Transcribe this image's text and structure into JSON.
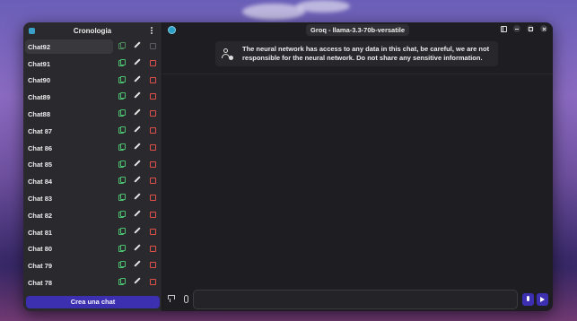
{
  "sidebar": {
    "title": "Cronologia",
    "chats": [
      {
        "label": "Chat92",
        "active": true
      },
      {
        "label": "Chat91"
      },
      {
        "label": "Chat90"
      },
      {
        "label": "Chat89"
      },
      {
        "label": "Chat88"
      },
      {
        "label": "Chat 87"
      },
      {
        "label": "Chat 86"
      },
      {
        "label": "Chat 85"
      },
      {
        "label": "Chat 84"
      },
      {
        "label": "Chat 83"
      },
      {
        "label": "Chat 82"
      },
      {
        "label": "Chat 81"
      },
      {
        "label": "Chat 80"
      },
      {
        "label": "Chat 79"
      },
      {
        "label": "Chat 78"
      }
    ],
    "new_chat_label": "Crea una chat"
  },
  "header": {
    "model_title": "Groq - llama-3.3-70b-versatile"
  },
  "banner": {
    "text": "The neural network has access to any data in this chat, be careful, we are not responsible for the neural network. Do not share any sensitive information."
  },
  "input": {
    "value": "",
    "placeholder": ""
  },
  "icons": {
    "app": "app-logo-icon",
    "menu": "kebab-menu-icon",
    "copy": "copy-icon",
    "edit": "pencil-icon",
    "delete": "trash-icon",
    "model": "model-avatar-icon",
    "sidebar_toggle": "sidebar-toggle-icon",
    "minimize": "minimize-icon",
    "maximize": "maximize-icon",
    "close": "close-icon",
    "info": "user-info-icon",
    "hand": "hand-icon",
    "attach": "paperclip-icon",
    "mic": "microphone-icon",
    "send": "send-arrow-icon"
  },
  "colors": {
    "accent": "#3c2fb0",
    "copy": "#4cc070",
    "delete": "#e0504a",
    "window_bg": "#1e1e22",
    "sidebar_bg": "#2a2a2e"
  }
}
